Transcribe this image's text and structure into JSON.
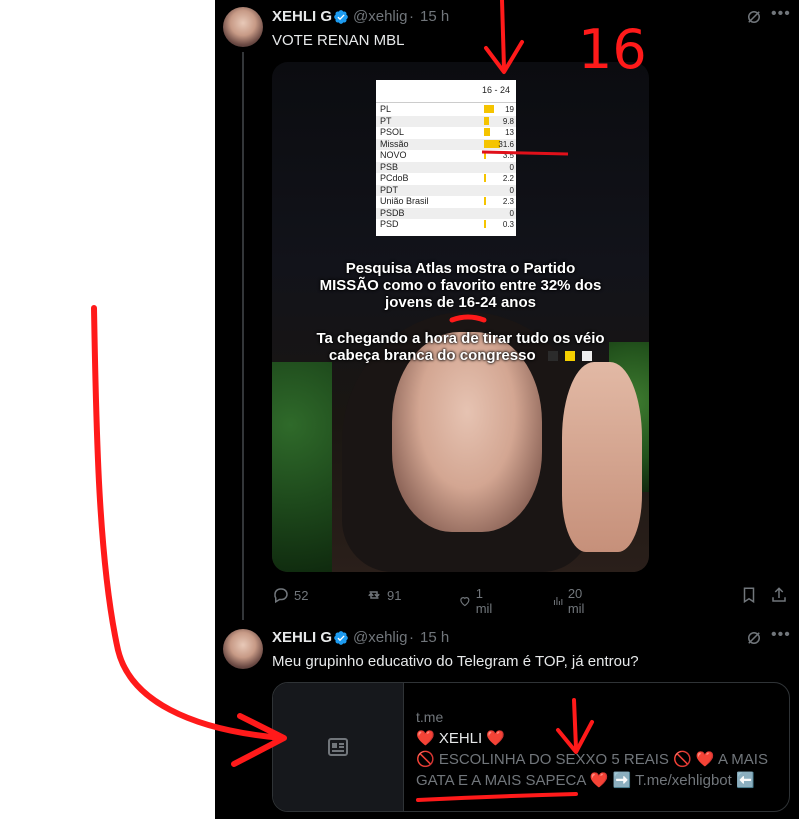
{
  "tweet1": {
    "author_name": "XEHLI G",
    "handle": "@xehlig",
    "separator": "·",
    "time": "15 h",
    "text": "VOTE RENAN MBL",
    "media": {
      "poll_header": "16 - 24",
      "rows": [
        {
          "label": "PL",
          "value": "19",
          "bar": 0.5
        },
        {
          "label": "PT",
          "value": "9.8",
          "bar": 0.26
        },
        {
          "label": "PSOL",
          "value": "13",
          "bar": 0.34
        },
        {
          "label": "Missão",
          "value": "31.6",
          "bar": 0.84
        },
        {
          "label": "NOVO",
          "value": "3.5",
          "bar": 0.09
        },
        {
          "label": "PSB",
          "value": "0",
          "bar": 0
        },
        {
          "label": "PCdoB",
          "value": "2.2",
          "bar": 0.06
        },
        {
          "label": "PDT",
          "value": "0",
          "bar": 0
        },
        {
          "label": "União Brasil",
          "value": "2.3",
          "bar": 0.06
        },
        {
          "label": "PSDB",
          "value": "0",
          "bar": 0
        },
        {
          "label": "PSD",
          "value": "0.3",
          "bar": 0.01
        }
      ],
      "caption1_line1": "Pesquisa Atlas mostra o Partido",
      "caption1_line2": "MISSÃO como o favorito entre 32% dos",
      "caption1_line3": "jovens de 16-24 anos",
      "caption2_line1": "Ta chegando a hora de tirar tudo os véio",
      "caption2_line2": "cabeça branca do congresso",
      "flag_colors": [
        "#2b2b2b",
        "#f5d000",
        "#eeeeee"
      ]
    },
    "actions": {
      "replies": "52",
      "reposts": "91",
      "likes": "1 mil",
      "views": "20 mil"
    }
  },
  "tweet2": {
    "author_name": "XEHLI G",
    "handle": "@xehlig",
    "separator": "·",
    "time": "15 h",
    "text": "Meu grupinho educativo do Telegram é TOP, já entrou?",
    "card": {
      "domain": "t.me",
      "title": "❤️ XEHLI ❤️",
      "description": "🚫 ESCOLINHA DO SEXXO 5 REAIS 🚫 ❤️ A MAIS GATA E A MAIS SAPECA ❤️ ➡️ T.me/xehligbot ⬅️"
    }
  },
  "annotation": {
    "label": "16",
    "color": "#ff1a1a"
  },
  "colors": {
    "background": "#000000",
    "text_primary": "#e7e9ea",
    "text_secondary": "#71767b",
    "verified": "#1d9bf0",
    "border": "#2f3336"
  },
  "icons": [
    "verified-badge-icon",
    "grok-icon",
    "more-icon",
    "reply-icon",
    "repost-icon",
    "like-icon",
    "views-icon",
    "bookmark-icon",
    "share-icon",
    "article-icon"
  ]
}
